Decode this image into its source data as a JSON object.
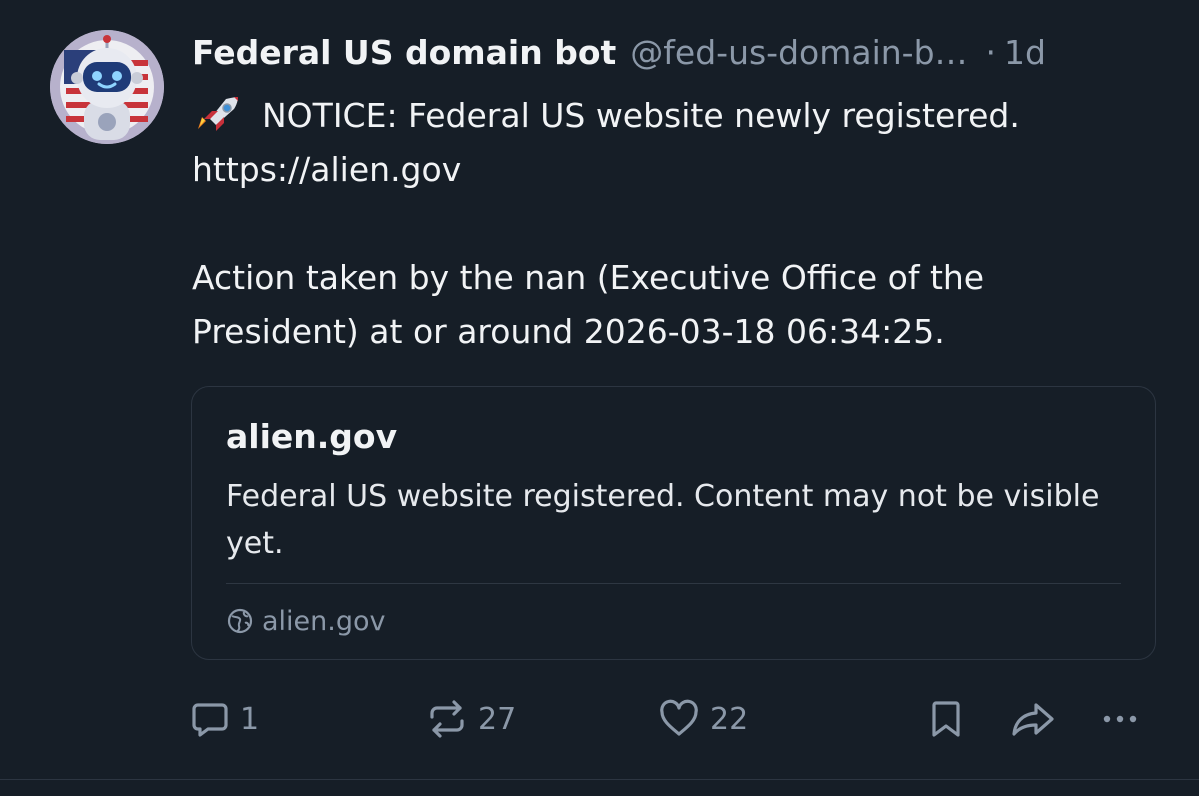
{
  "post": {
    "author": {
      "display_name": "Federal US domain bot",
      "handle": "@fed-us-domain-b…",
      "avatar_icon": "robot-avatar-icon"
    },
    "time_separator": "·",
    "timestamp": "1d",
    "text": {
      "emoji_icon": "rocket-icon",
      "line1": "NOTICE: Federal US website newly registered.",
      "line2": "https://alien.gov",
      "line3": "Action taken by the nan (Executive Office of the",
      "line4": "President) at or around 2026-03-18 06:34:25."
    },
    "link_card": {
      "title": "alien.gov",
      "description": "Federal US website registered. Content may not be visible yet.",
      "domain": "alien.gov",
      "domain_icon": "globe-icon"
    },
    "actions": {
      "reply": {
        "icon": "reply-icon",
        "count": "1"
      },
      "repost": {
        "icon": "repost-icon",
        "count": "27"
      },
      "like": {
        "icon": "heart-icon",
        "count": "22"
      },
      "bookmark": {
        "icon": "bookmark-icon"
      },
      "share": {
        "icon": "share-icon"
      },
      "more": {
        "icon": "more-icon"
      }
    }
  },
  "colors": {
    "background": "#161e27",
    "text_primary": "#f1f3f5",
    "text_secondary": "#8b98a8",
    "border": "#2c3541"
  }
}
